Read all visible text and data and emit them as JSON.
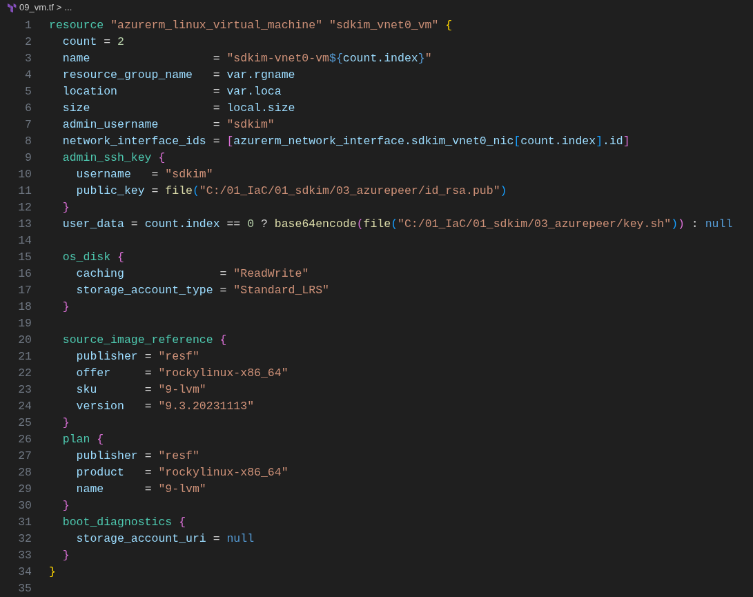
{
  "breadcrumb": {
    "file": "09_vm.tf",
    "separator": ">",
    "more": "..."
  },
  "lines": [
    {
      "number": "1",
      "tokens": [
        {
          "kind": "kw",
          "text": "resource "
        },
        {
          "kind": "str",
          "text": "\"azurerm_linux_virtual_machine\" \"sdkim_vnet0_vm\" "
        },
        {
          "kind": "b1",
          "text": "{"
        }
      ]
    },
    {
      "number": "2",
      "tokens": [
        {
          "kind": "attr",
          "text": "  count "
        },
        {
          "kind": "op",
          "text": "= "
        },
        {
          "kind": "num",
          "text": "2"
        }
      ]
    },
    {
      "number": "3",
      "tokens": [
        {
          "kind": "attr",
          "text": "  name                  "
        },
        {
          "kind": "op",
          "text": "= "
        },
        {
          "kind": "str",
          "text": "\"sdkim-vnet0-vm"
        },
        {
          "kind": "interp",
          "text": "${"
        },
        {
          "kind": "attr",
          "text": "count.index"
        },
        {
          "kind": "interp",
          "text": "}"
        },
        {
          "kind": "str",
          "text": "\""
        }
      ]
    },
    {
      "number": "4",
      "tokens": [
        {
          "kind": "attr",
          "text": "  resource_group_name   "
        },
        {
          "kind": "op",
          "text": "= "
        },
        {
          "kind": "attr",
          "text": "var.rgname"
        }
      ]
    },
    {
      "number": "5",
      "tokens": [
        {
          "kind": "attr",
          "text": "  location              "
        },
        {
          "kind": "op",
          "text": "= "
        },
        {
          "kind": "attr",
          "text": "var.loca"
        }
      ]
    },
    {
      "number": "6",
      "tokens": [
        {
          "kind": "attr",
          "text": "  size                  "
        },
        {
          "kind": "op",
          "text": "= "
        },
        {
          "kind": "attr",
          "text": "local.size"
        }
      ]
    },
    {
      "number": "7",
      "tokens": [
        {
          "kind": "attr",
          "text": "  admin_username        "
        },
        {
          "kind": "op",
          "text": "= "
        },
        {
          "kind": "str",
          "text": "\"sdkim\""
        }
      ]
    },
    {
      "number": "8",
      "tokens": [
        {
          "kind": "attr",
          "text": "  network_interface_ids "
        },
        {
          "kind": "op",
          "text": "= "
        },
        {
          "kind": "b2",
          "text": "["
        },
        {
          "kind": "attr",
          "text": "azurerm_network_interface.sdkim_vnet0_nic"
        },
        {
          "kind": "b3",
          "text": "["
        },
        {
          "kind": "attr",
          "text": "count.index"
        },
        {
          "kind": "b3",
          "text": "]"
        },
        {
          "kind": "attr",
          "text": ".id"
        },
        {
          "kind": "b2",
          "text": "]"
        }
      ]
    },
    {
      "number": "9",
      "tokens": [
        {
          "kind": "kw",
          "text": "  admin_ssh_key "
        },
        {
          "kind": "b2",
          "text": "{"
        }
      ]
    },
    {
      "number": "10",
      "tokens": [
        {
          "kind": "attr",
          "text": "    username   "
        },
        {
          "kind": "op",
          "text": "= "
        },
        {
          "kind": "str",
          "text": "\"sdkim\""
        }
      ]
    },
    {
      "number": "11",
      "tokens": [
        {
          "kind": "attr",
          "text": "    public_key "
        },
        {
          "kind": "op",
          "text": "= "
        },
        {
          "kind": "fn",
          "text": "file"
        },
        {
          "kind": "b3",
          "text": "("
        },
        {
          "kind": "str",
          "text": "\"C:/01_IaC/01_sdkim/03_azurepeer/id_rsa.pub\""
        },
        {
          "kind": "b3",
          "text": ")"
        }
      ]
    },
    {
      "number": "12",
      "tokens": [
        {
          "kind": "b2",
          "text": "  }"
        }
      ]
    },
    {
      "number": "13",
      "tokens": [
        {
          "kind": "attr",
          "text": "  user_data "
        },
        {
          "kind": "op",
          "text": "= "
        },
        {
          "kind": "attr",
          "text": "count.index "
        },
        {
          "kind": "op",
          "text": "== "
        },
        {
          "kind": "num",
          "text": "0"
        },
        {
          "kind": "op",
          "text": " ? "
        },
        {
          "kind": "fn",
          "text": "base64encode"
        },
        {
          "kind": "b2",
          "text": "("
        },
        {
          "kind": "fn",
          "text": "file"
        },
        {
          "kind": "b3",
          "text": "("
        },
        {
          "kind": "str",
          "text": "\"C:/01_IaC/01_sdkim/03_azurepeer/key.sh\""
        },
        {
          "kind": "b3",
          "text": ")"
        },
        {
          "kind": "b2",
          "text": ")"
        },
        {
          "kind": "op",
          "text": " : "
        },
        {
          "kind": "null",
          "text": "null"
        }
      ]
    },
    {
      "number": "14"
    },
    {
      "number": "15",
      "tokens": [
        {
          "kind": "kw",
          "text": "  os_disk "
        },
        {
          "kind": "b2",
          "text": "{"
        }
      ]
    },
    {
      "number": "16",
      "tokens": [
        {
          "kind": "attr",
          "text": "    caching              "
        },
        {
          "kind": "op",
          "text": "= "
        },
        {
          "kind": "str",
          "text": "\"ReadWrite\""
        }
      ]
    },
    {
      "number": "17",
      "tokens": [
        {
          "kind": "attr",
          "text": "    storage_account_type "
        },
        {
          "kind": "op",
          "text": "= "
        },
        {
          "kind": "str",
          "text": "\"Standard_LRS\""
        }
      ]
    },
    {
      "number": "18",
      "tokens": [
        {
          "kind": "b2",
          "text": "  }"
        }
      ]
    },
    {
      "number": "19"
    },
    {
      "number": "20",
      "tokens": [
        {
          "kind": "kw",
          "text": "  source_image_reference "
        },
        {
          "kind": "b2",
          "text": "{"
        }
      ]
    },
    {
      "number": "21",
      "tokens": [
        {
          "kind": "attr",
          "text": "    publisher "
        },
        {
          "kind": "op",
          "text": "= "
        },
        {
          "kind": "str",
          "text": "\"resf\""
        }
      ]
    },
    {
      "number": "22",
      "tokens": [
        {
          "kind": "attr",
          "text": "    offer     "
        },
        {
          "kind": "op",
          "text": "= "
        },
        {
          "kind": "str",
          "text": "\"rockylinux-x86_64\""
        }
      ]
    },
    {
      "number": "23",
      "tokens": [
        {
          "kind": "attr",
          "text": "    sku       "
        },
        {
          "kind": "op",
          "text": "= "
        },
        {
          "kind": "str",
          "text": "\"9-lvm\""
        }
      ]
    },
    {
      "number": "24",
      "tokens": [
        {
          "kind": "attr",
          "text": "    version   "
        },
        {
          "kind": "op",
          "text": "= "
        },
        {
          "kind": "str",
          "text": "\"9.3.20231113\""
        }
      ]
    },
    {
      "number": "25",
      "tokens": [
        {
          "kind": "b2",
          "text": "  }"
        }
      ]
    },
    {
      "number": "26",
      "tokens": [
        {
          "kind": "kw",
          "text": "  plan "
        },
        {
          "kind": "b2",
          "text": "{"
        }
      ]
    },
    {
      "number": "27",
      "tokens": [
        {
          "kind": "attr",
          "text": "    publisher "
        },
        {
          "kind": "op",
          "text": "= "
        },
        {
          "kind": "str",
          "text": "\"resf\""
        }
      ]
    },
    {
      "number": "28",
      "tokens": [
        {
          "kind": "attr",
          "text": "    product   "
        },
        {
          "kind": "op",
          "text": "= "
        },
        {
          "kind": "str",
          "text": "\"rockylinux-x86_64\""
        }
      ]
    },
    {
      "number": "29",
      "tokens": [
        {
          "kind": "attr",
          "text": "    name      "
        },
        {
          "kind": "op",
          "text": "= "
        },
        {
          "kind": "str",
          "text": "\"9-lvm\""
        }
      ]
    },
    {
      "number": "30",
      "tokens": [
        {
          "kind": "b2",
          "text": "  }"
        }
      ]
    },
    {
      "number": "31",
      "tokens": [
        {
          "kind": "kw",
          "text": "  boot_diagnostics "
        },
        {
          "kind": "b2",
          "text": "{"
        }
      ]
    },
    {
      "number": "32",
      "tokens": [
        {
          "kind": "attr",
          "text": "    storage_account_uri "
        },
        {
          "kind": "op",
          "text": "= "
        },
        {
          "kind": "null",
          "text": "null"
        }
      ]
    },
    {
      "number": "33",
      "tokens": [
        {
          "kind": "b2",
          "text": "  }"
        }
      ]
    },
    {
      "number": "34",
      "tokens": [
        {
          "kind": "b1",
          "text": "}"
        }
      ]
    },
    {
      "number": "35"
    }
  ]
}
